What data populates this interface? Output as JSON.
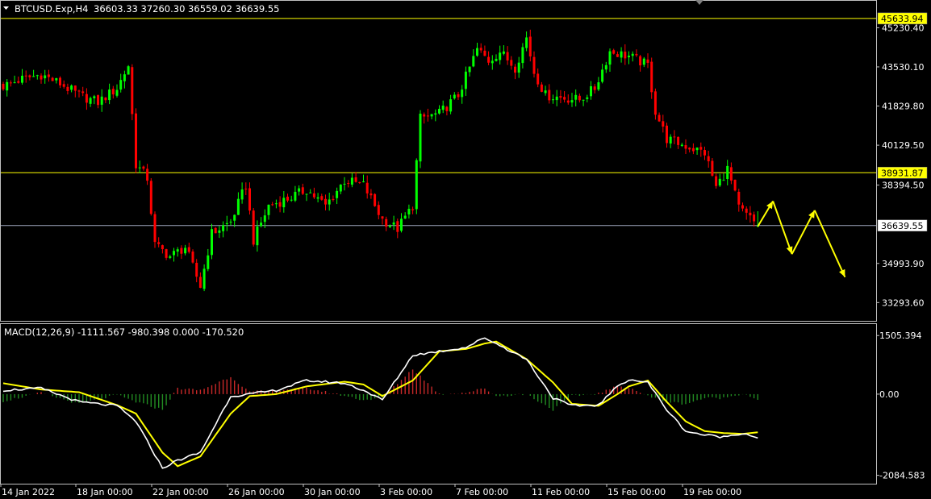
{
  "header": {
    "symbol": "BTCUSD.Exp,H4",
    "ohlc": "36603.33 37260.30 36559.02 36639.55",
    "macd_label": "MACD(12,26,9) -1111.567 -980.398 0.000 -170.520"
  },
  "colors": {
    "background": "#000000",
    "axis": "#c0c0c0",
    "bull": "#00ff00",
    "bear": "#ff0000",
    "hline": "#ffff00",
    "price_line": "#a0a8c0",
    "signal": "#ffff00",
    "macd": "#ffffff",
    "hist_pos": "#c82828",
    "hist_neg": "#228b22",
    "arrow": "#ffff00"
  },
  "price_axis": {
    "min": 32500,
    "max": 46400,
    "ticks": [
      "45230.40",
      "43530.10",
      "41829.80",
      "40129.50",
      "38394.50",
      "34993.90",
      "33293.60"
    ],
    "tick_values": [
      45230.4,
      43530.1,
      41829.8,
      40129.5,
      38394.5,
      34993.9,
      33293.6
    ]
  },
  "macd_axis": {
    "min": -2300,
    "max": 1800,
    "ticks": [
      "1505.394",
      "0.00",
      "-2084.583"
    ],
    "tick_values": [
      1505.394,
      0.0,
      -2084.583
    ]
  },
  "time_axis": {
    "labels": [
      "14 Jan 2022",
      "18 Jan 00:00",
      "22 Jan 00:00",
      "26 Jan 00:00",
      "30 Jan 00:00",
      "3 Feb 00:00",
      "7 Feb 00:00",
      "11 Feb 00:00",
      "15 Feb 00:00",
      "19 Feb 00:00"
    ],
    "label_bars": [
      0,
      20,
      40,
      60,
      80,
      100,
      120,
      140,
      160,
      180
    ]
  },
  "horizontal_levels": [
    {
      "value": 45633.94,
      "label": "45633.94",
      "kind": "resistance"
    },
    {
      "value": 38931.87,
      "label": "38931.87",
      "kind": "support"
    },
    {
      "value": 36639.55,
      "label": "36639.55",
      "kind": "current"
    }
  ],
  "chart_data": {
    "type": "candlestick",
    "timeframe": "H4",
    "bar_count": 200,
    "close_anchors": [
      {
        "bar": 0,
        "close": 42700
      },
      {
        "bar": 5,
        "close": 43000
      },
      {
        "bar": 10,
        "close": 43200
      },
      {
        "bar": 15,
        "close": 42800
      },
      {
        "bar": 20,
        "close": 42300
      },
      {
        "bar": 25,
        "close": 42000
      },
      {
        "bar": 30,
        "close": 42600
      },
      {
        "bar": 33,
        "close": 43600
      },
      {
        "bar": 35,
        "close": 39300
      },
      {
        "bar": 38,
        "close": 38700
      },
      {
        "bar": 40,
        "close": 35800
      },
      {
        "bar": 44,
        "close": 35300
      },
      {
        "bar": 48,
        "close": 35700
      },
      {
        "bar": 52,
        "close": 34000
      },
      {
        "bar": 55,
        "close": 36300
      },
      {
        "bar": 60,
        "close": 36800
      },
      {
        "bar": 64,
        "close": 38400
      },
      {
        "bar": 66,
        "close": 36000
      },
      {
        "bar": 70,
        "close": 37500
      },
      {
        "bar": 75,
        "close": 37800
      },
      {
        "bar": 80,
        "close": 38200
      },
      {
        "bar": 85,
        "close": 37500
      },
      {
        "bar": 90,
        "close": 38600
      },
      {
        "bar": 95,
        "close": 38400
      },
      {
        "bar": 100,
        "close": 36900
      },
      {
        "bar": 104,
        "close": 36500
      },
      {
        "bar": 108,
        "close": 37500
      },
      {
        "bar": 110,
        "close": 41300
      },
      {
        "bar": 115,
        "close": 41500
      },
      {
        "bar": 120,
        "close": 42300
      },
      {
        "bar": 125,
        "close": 44300
      },
      {
        "bar": 128,
        "close": 43800
      },
      {
        "bar": 131,
        "close": 44200
      },
      {
        "bar": 135,
        "close": 43500
      },
      {
        "bar": 138,
        "close": 44800
      },
      {
        "bar": 140,
        "close": 43300
      },
      {
        "bar": 143,
        "close": 42300
      },
      {
        "bar": 147,
        "close": 42200
      },
      {
        "bar": 152,
        "close": 42100
      },
      {
        "bar": 156,
        "close": 42600
      },
      {
        "bar": 160,
        "close": 44200
      },
      {
        "bar": 165,
        "close": 44000
      },
      {
        "bar": 170,
        "close": 43600
      },
      {
        "bar": 172,
        "close": 41600
      },
      {
        "bar": 175,
        "close": 40400
      },
      {
        "bar": 180,
        "close": 40100
      },
      {
        "bar": 185,
        "close": 39800
      },
      {
        "bar": 188,
        "close": 38300
      },
      {
        "bar": 191,
        "close": 39100
      },
      {
        "bar": 194,
        "close": 37400
      },
      {
        "bar": 199,
        "close": 36640
      }
    ],
    "macd_anchors": [
      {
        "bar": 0,
        "macd": 100,
        "signal": 280
      },
      {
        "bar": 10,
        "macd": 150,
        "signal": 120
      },
      {
        "bar": 20,
        "macd": -200,
        "signal": 50
      },
      {
        "bar": 30,
        "macd": -300,
        "signal": -280
      },
      {
        "bar": 35,
        "macd": -700,
        "signal": -500
      },
      {
        "bar": 42,
        "macd": -1900,
        "signal": -1500
      },
      {
        "bar": 46,
        "macd": -1700,
        "signal": -1850
      },
      {
        "bar": 52,
        "macd": -1500,
        "signal": -1600
      },
      {
        "bar": 60,
        "macd": -50,
        "signal": -500
      },
      {
        "bar": 65,
        "macd": 0,
        "signal": -50
      },
      {
        "bar": 72,
        "macd": 100,
        "signal": 0
      },
      {
        "bar": 80,
        "macd": 350,
        "signal": 200
      },
      {
        "bar": 90,
        "macd": 280,
        "signal": 320
      },
      {
        "bar": 95,
        "macd": 100,
        "signal": 250
      },
      {
        "bar": 100,
        "macd": -150,
        "signal": -50
      },
      {
        "bar": 108,
        "macd": 1000,
        "signal": 350
      },
      {
        "bar": 115,
        "macd": 1100,
        "signal": 1100
      },
      {
        "bar": 122,
        "macd": 1200,
        "signal": 1160
      },
      {
        "bar": 127,
        "macd": 1450,
        "signal": 1300
      },
      {
        "bar": 130,
        "macd": 1300,
        "signal": 1350
      },
      {
        "bar": 138,
        "macd": 900,
        "signal": 900
      },
      {
        "bar": 145,
        "macd": -100,
        "signal": 300
      },
      {
        "bar": 150,
        "macd": -300,
        "signal": -250
      },
      {
        "bar": 157,
        "macd": -280,
        "signal": -300
      },
      {
        "bar": 162,
        "macd": 200,
        "signal": 0
      },
      {
        "bar": 165,
        "macd": 380,
        "signal": 200
      },
      {
        "bar": 170,
        "macd": 300,
        "signal": 350
      },
      {
        "bar": 175,
        "macd": -400,
        "signal": -200
      },
      {
        "bar": 180,
        "macd": -950,
        "signal": -700
      },
      {
        "bar": 185,
        "macd": -1050,
        "signal": -950
      },
      {
        "bar": 190,
        "macd": -1100,
        "signal": -1000
      },
      {
        "bar": 195,
        "macd": -1000,
        "signal": -1020
      },
      {
        "bar": 199,
        "macd": -1111.567,
        "signal": -980.398
      }
    ],
    "forecast_path": [
      {
        "bar": 199,
        "price": 36600
      },
      {
        "bar": 203,
        "price": 37700
      },
      {
        "bar": 208,
        "price": 35400
      },
      {
        "bar": 214,
        "price": 37300
      },
      {
        "bar": 222,
        "price": 34400
      }
    ],
    "last_values": {
      "open": 36603.33,
      "high": 37260.3,
      "low": 36559.02,
      "close": 36639.55,
      "macd": -1111.567,
      "signal": -980.398
    }
  }
}
